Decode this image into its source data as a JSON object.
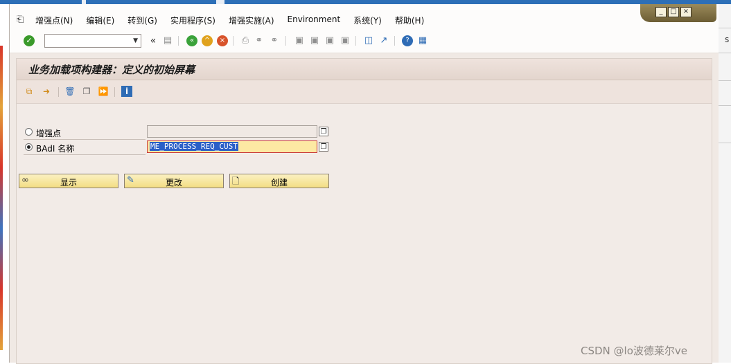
{
  "menu": {
    "items": [
      "增强点(N)",
      "编辑(E)",
      "转到(G)",
      "实用程序(S)",
      "增强实施(A)",
      "Environment",
      "系统(Y)",
      "帮助(H)"
    ]
  },
  "window_controls": {
    "minimize": "_",
    "maximize": "□",
    "close": "×"
  },
  "toolbar": {
    "command_field_value": "",
    "enter_icon": "check-circle-icon",
    "icons": [
      "back-icon",
      "exit-icon",
      "cancel-icon",
      "print-icon",
      "find-icon",
      "find-next-icon",
      "first-page-icon",
      "prev-page-icon",
      "next-page-icon",
      "last-page-icon",
      "create-session-icon",
      "shortcut-icon",
      "help-icon",
      "customize-layout-icon"
    ]
  },
  "screen": {
    "title": "业务加载项构建器：定义的初始屏幕",
    "app_toolbar_icons": [
      "other-object-icon",
      "display-object-icon",
      "delete-icon",
      "copy-icon",
      "rename-icon",
      "info-icon"
    ],
    "radio_enhancement_point": {
      "label": "增强点",
      "selected": false,
      "value": ""
    },
    "radio_badi_name": {
      "label": "BAdI 名称",
      "selected": true,
      "value": "ME_PROCESS_REQ_CUST"
    },
    "buttons": {
      "display": "显示",
      "change": "更改",
      "create": "创建"
    }
  },
  "desktop": {
    "right_edge_letter": "s"
  },
  "watermark": "CSDN @lo波德莱尔ve"
}
